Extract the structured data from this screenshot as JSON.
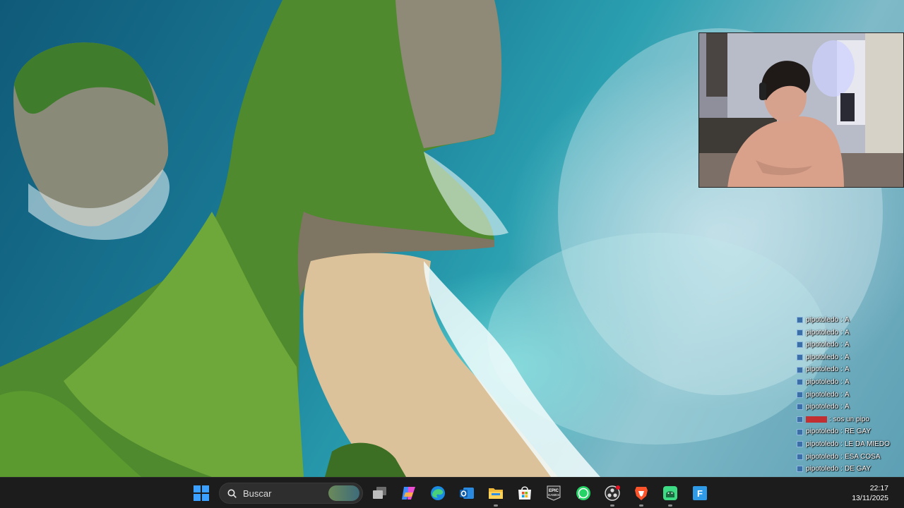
{
  "desktop": {
    "wallpaper_icon": "landscape-wallpaper"
  },
  "webcam": {
    "icon": "webcam-feed"
  },
  "chat": {
    "messages": [
      {
        "user": "pipotoledo",
        "text": "A",
        "user_color": "#ffffff"
      },
      {
        "user": "pipotoledo",
        "text": "A",
        "user_color": "#ffffff"
      },
      {
        "user": "pipotoledo",
        "text": "A",
        "user_color": "#ffffff"
      },
      {
        "user": "pipotoledo",
        "text": "A",
        "user_color": "#ffffff"
      },
      {
        "user": "pipotoledo",
        "text": "A",
        "user_color": "#ffffff"
      },
      {
        "user": "pipotoledo",
        "text": "A",
        "user_color": "#ffffff"
      },
      {
        "user": "pipotoledo",
        "text": "A",
        "user_color": "#ffffff"
      },
      {
        "user": "pipotoledo",
        "text": "A",
        "user_color": "#ffffff"
      },
      {
        "user": "",
        "text": "sos un pipo",
        "user_color": "#d11a1a"
      },
      {
        "user": "pipotoledo",
        "text": "RE GAY",
        "user_color": "#ffffff"
      },
      {
        "user": "pipotoledo",
        "text": "LE DA MIEDO",
        "user_color": "#ffffff"
      },
      {
        "user": "pipotoledo",
        "text": "ESA COSA",
        "user_color": "#ffffff"
      },
      {
        "user": "pipotoledo",
        "text": "DE GAY",
        "user_color": "#ffffff"
      }
    ]
  },
  "taskbar": {
    "search_placeholder": "Buscar",
    "apps": [
      {
        "name": "task-view-icon"
      },
      {
        "name": "copilot-icon"
      },
      {
        "name": "edge-icon"
      },
      {
        "name": "outlook-icon"
      },
      {
        "name": "file-explorer-icon"
      },
      {
        "name": "microsoft-store-icon"
      },
      {
        "name": "epic-games-icon",
        "label": "EPIC\nGAMES"
      },
      {
        "name": "whatsapp-icon"
      },
      {
        "name": "obs-icon"
      },
      {
        "name": "brave-icon"
      },
      {
        "name": "android-app-icon"
      },
      {
        "name": "file-icon",
        "label": "F"
      }
    ],
    "clock": {
      "time": "22:17",
      "date": "13/11/2025"
    }
  },
  "colors": {
    "taskbar_bg": "#1c1c1c",
    "chat_badge": "#3b6fa8",
    "chat_red_user": "#d11a1a"
  }
}
